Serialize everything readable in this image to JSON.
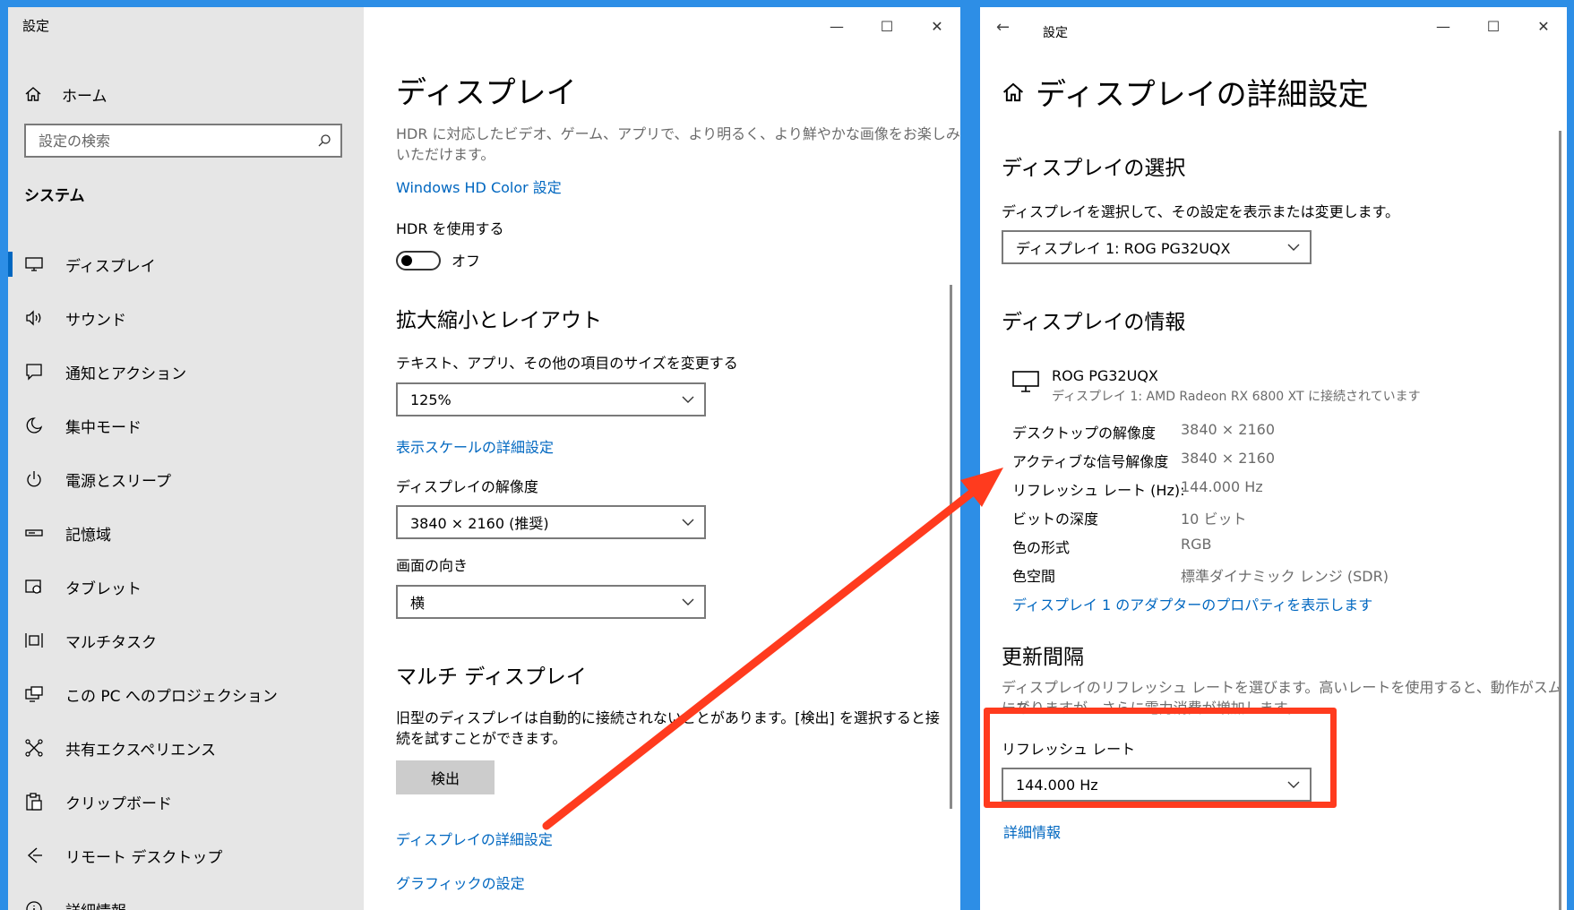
{
  "left_window": {
    "title": "設定",
    "controls": {
      "minimize": "—",
      "maximize": "☐",
      "close": "✕"
    },
    "sidebar": {
      "home_label": "ホーム",
      "search_placeholder": "設定の検索",
      "section_label": "システム",
      "items": [
        {
          "label": "ディスプレイ",
          "icon": "monitor-icon",
          "selected": true
        },
        {
          "label": "サウンド",
          "icon": "speaker-icon"
        },
        {
          "label": "通知とアクション",
          "icon": "notification-icon"
        },
        {
          "label": "集中モード",
          "icon": "moon-icon"
        },
        {
          "label": "電源とスリープ",
          "icon": "power-icon"
        },
        {
          "label": "記憶域",
          "icon": "storage-icon"
        },
        {
          "label": "タブレット",
          "icon": "tablet-icon"
        },
        {
          "label": "マルチタスク",
          "icon": "multitask-icon"
        },
        {
          "label": "この PC へのプロジェクション",
          "icon": "projection-icon"
        },
        {
          "label": "共有エクスペリエンス",
          "icon": "share-icon"
        },
        {
          "label": "クリップボード",
          "icon": "clipboard-icon"
        },
        {
          "label": "リモート デスクトップ",
          "icon": "remote-desktop-icon"
        },
        {
          "label": "詳細情報",
          "icon": "info-icon"
        }
      ]
    },
    "content": {
      "title": "ディスプレイ",
      "hdr_desc_1": "HDR に対応したビデオ、ゲーム、アプリで、より明るく、より鮮やかな画像をお楽しみ",
      "hdr_desc_2": "いただけます。",
      "hd_color_link": "Windows HD Color 設定",
      "hdr_toggle_label": "HDR を使用する",
      "hdr_toggle_state": "オフ",
      "scale_heading": "拡大縮小とレイアウト",
      "scale_label": "テキスト、アプリ、その他の項目のサイズを変更する",
      "scale_value": "125%",
      "scale_link": "表示スケールの詳細設定",
      "resolution_label": "ディスプレイの解像度",
      "resolution_value": "3840 × 2160 (推奨)",
      "orientation_label": "画面の向き",
      "orientation_value": "横",
      "multi_heading": "マルチ ディスプレイ",
      "multi_desc_1": "旧型のディスプレイは自動的に接続されないことがあります。[検出] を選択すると接",
      "multi_desc_2": "続を試すことができます。",
      "detect_button": "検出",
      "advanced_link": "ディスプレイの詳細設定",
      "graphics_link": "グラフィックの設定"
    }
  },
  "right_window": {
    "title": "設定",
    "back": "←",
    "controls": {
      "minimize": "—",
      "maximize": "☐",
      "close": "✕"
    },
    "page_title": "ディスプレイの詳細設定",
    "select_heading": "ディスプレイの選択",
    "select_desc": "ディスプレイを選択して、その設定を表示または変更します。",
    "display_dropdown": "ディスプレイ 1: ROG PG32UQX",
    "info_heading": "ディスプレイの情報",
    "monitor_name": "ROG PG32UQX",
    "monitor_sub": "ディスプレイ 1: AMD Radeon RX 6800 XT に接続されています",
    "info_rows": [
      {
        "label": "デスクトップの解像度",
        "value": "3840 × 2160"
      },
      {
        "label": "アクティブな信号解像度",
        "value": "3840 × 2160"
      },
      {
        "label": "リフレッシュ レート (Hz):",
        "value": "144.000 Hz"
      },
      {
        "label": "ビットの深度",
        "value": "10 ビット"
      },
      {
        "label": "色の形式",
        "value": "RGB"
      },
      {
        "label": "色空間",
        "value": "標準ダイナミック レンジ (SDR)"
      }
    ],
    "adapter_link": "ディスプレイ 1 のアダプターのプロパティを表示します",
    "refresh_heading": "更新間隔",
    "refresh_desc_1": "ディスプレイのリフレッシュ レートを選びます。高いレートを使用すると、動作がスムーズ",
    "refresh_desc_2": "になりますが、さらに電力消費が増加します。",
    "refresh_label": "リフレッシュ レート",
    "refresh_value": "144.000 Hz",
    "details_link": "詳細情報"
  },
  "colors": {
    "background": "#2d8ee6",
    "accent": "#0067c0",
    "sidebar": "#e6e6e6",
    "annotation": "#ff3b1e"
  }
}
